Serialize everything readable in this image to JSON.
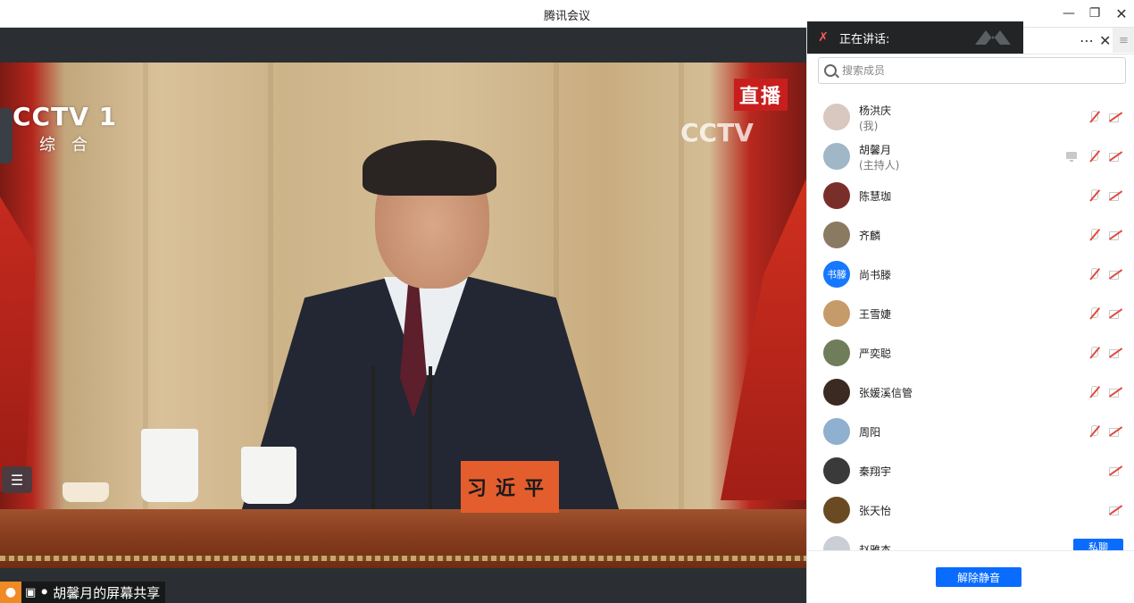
{
  "window": {
    "title": "腾讯会议",
    "minimize_icon": "minimize-icon",
    "maximize_icon": "restore-icon",
    "close_icon": "close-icon"
  },
  "video": {
    "channel_logo": "CCTV 1",
    "channel_sub": "综合",
    "live_badge": "直播",
    "corner_logo": "CCTV",
    "nameplate": "习近平",
    "share_label": "胡馨月的屏幕共享",
    "list_toggle_icon": "list-icon"
  },
  "panel": {
    "speaking_label": "正在讲话:",
    "more_icon": "⋯",
    "close_icon": "✕",
    "menu_icon": "≡",
    "search": {
      "placeholder": "搜索成员",
      "value": ""
    },
    "members": [
      {
        "name": "杨洪庆",
        "role": "(我)",
        "avatar_color": "#d8c8c0",
        "avatar_text": "",
        "icons": [
          "mic-off",
          "cam-off"
        ]
      },
      {
        "name": "胡馨月",
        "role": "(主持人)",
        "avatar_color": "#9fb7c6",
        "avatar_text": "",
        "icons": [
          "screen-share",
          "mic-off",
          "cam-off"
        ]
      },
      {
        "name": "陈慧珈",
        "role": "",
        "avatar_color": "#7a2e2a",
        "avatar_text": "",
        "icons": [
          "mic-off",
          "cam-off"
        ]
      },
      {
        "name": "齐麟",
        "role": "",
        "avatar_color": "#8a7a62",
        "avatar_text": "",
        "icons": [
          "mic-off",
          "cam-off"
        ]
      },
      {
        "name": "尚书滕",
        "role": "",
        "avatar_color": "#1677ff",
        "avatar_text": "书滕",
        "icons": [
          "mic-off",
          "cam-off"
        ]
      },
      {
        "name": "王雪婕",
        "role": "",
        "avatar_color": "#c79a6a",
        "avatar_text": "",
        "icons": [
          "mic-off",
          "cam-off"
        ]
      },
      {
        "name": "严奕聪",
        "role": "",
        "avatar_color": "#6f7d5a",
        "avatar_text": "",
        "icons": [
          "mic-off",
          "cam-off"
        ]
      },
      {
        "name": "张媛溪信管",
        "role": "",
        "avatar_color": "#3b2a22",
        "avatar_text": "",
        "icons": [
          "mic-off",
          "cam-off"
        ]
      },
      {
        "name": "周阳",
        "role": "",
        "avatar_color": "#8fb0cf",
        "avatar_text": "",
        "icons": [
          "mic-off",
          "cam-off"
        ]
      },
      {
        "name": "秦翔宇",
        "role": "",
        "avatar_color": "#3a3a3a",
        "avatar_text": "",
        "icons": [
          "cam-off"
        ]
      },
      {
        "name": "张天怡",
        "role": "",
        "avatar_color": "#6a4a22",
        "avatar_text": "",
        "icons": [
          "cam-off"
        ]
      },
      {
        "name": "赵雅杰",
        "role": "",
        "avatar_color": "#c9cfd4",
        "avatar_text": "",
        "icons": []
      }
    ],
    "private_chat_label": "私聊",
    "unmute_label": "解除静音"
  },
  "colors": {
    "accent": "#0a6cff",
    "muted_red": "#e2483c",
    "speaking_bar": "#222426"
  }
}
